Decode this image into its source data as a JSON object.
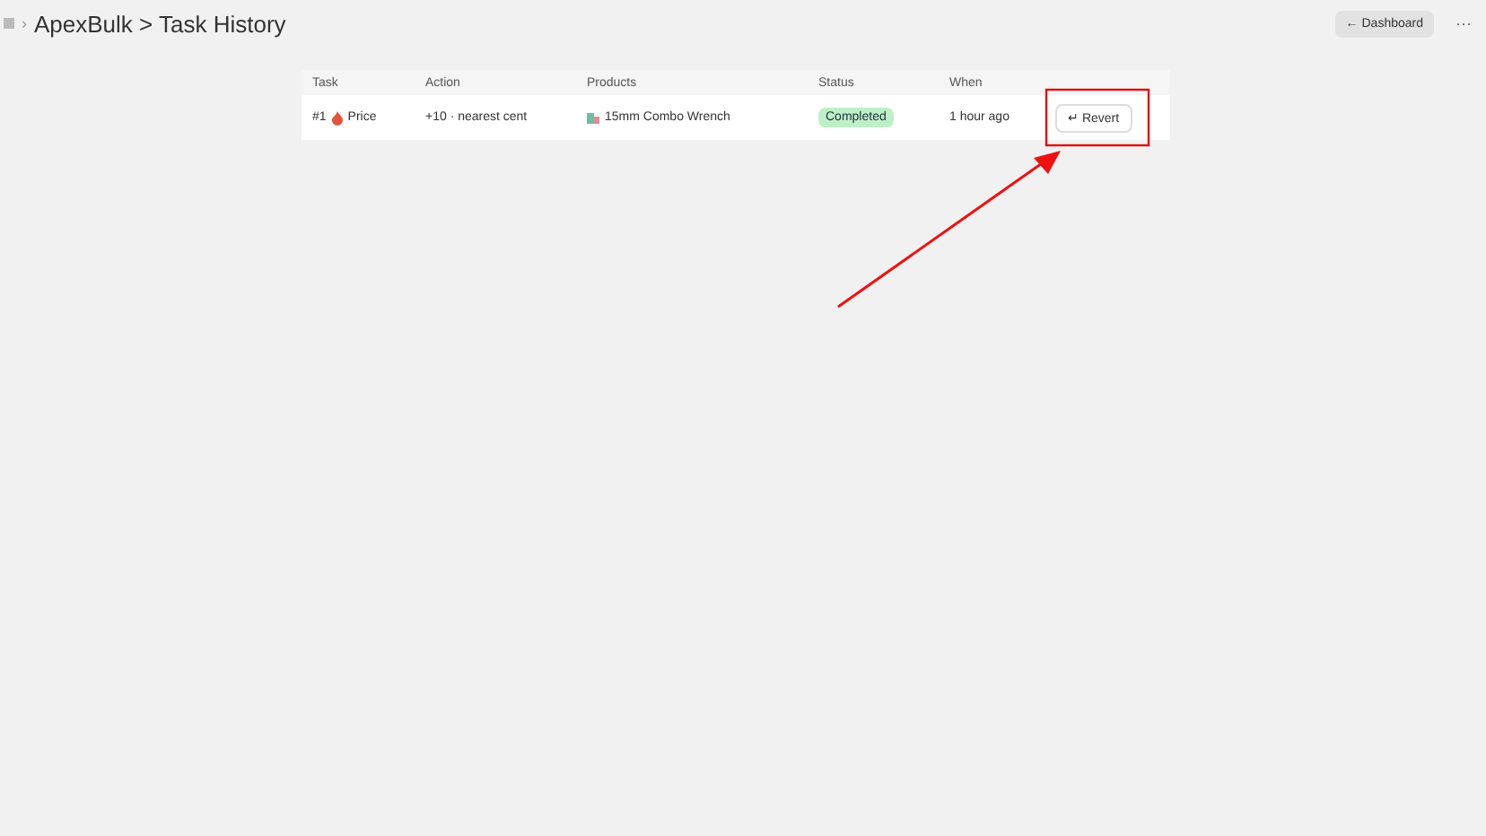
{
  "breadcrumb": {
    "separator": "›",
    "title": "ApexBulk > Task History"
  },
  "header_actions": {
    "back_button": "← Dashboard",
    "more": "···"
  },
  "table": {
    "columns": [
      "Task",
      "Action",
      "Products",
      "Status",
      "When"
    ],
    "rows": [
      {
        "task_number": "#1",
        "task_name": "Price",
        "action": "+10 · nearest cent",
        "product": "15mm Combo Wrench",
        "status": {
          "label": "Completed",
          "kind": "success"
        },
        "when": "1 hour ago",
        "button": "↵ Revert"
      }
    ]
  },
  "annotation": {
    "kind": "highlight-arrow"
  }
}
